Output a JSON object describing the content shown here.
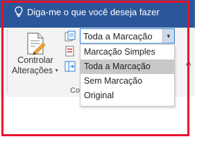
{
  "tellme": {
    "text": "Diga-me o que você deseja fazer"
  },
  "track_changes": {
    "label_line1": "Controlar",
    "label_line2": "Alterações"
  },
  "group": {
    "label": "Co"
  },
  "right_edge": {
    "text": "A"
  },
  "markup_combo": {
    "value": "Toda a Marcação",
    "options": [
      {
        "label": "Marcação Simples",
        "selected": false
      },
      {
        "label": "Toda a Marcação",
        "selected": true
      },
      {
        "label": "Sem Marcação",
        "selected": false
      },
      {
        "label": "Original",
        "selected": false
      }
    ]
  },
  "colors": {
    "titlebar": "#2b579a",
    "highlight_frame": "#e8102c",
    "selected_option": "#c8c8c8",
    "combo_border": "#2b7cd3"
  },
  "icons": [
    "lightbulb-icon",
    "track-changes-icon",
    "display-markup-icon",
    "show-markup-icon",
    "reviewing-pane-icon",
    "chevron-down-icon"
  ]
}
